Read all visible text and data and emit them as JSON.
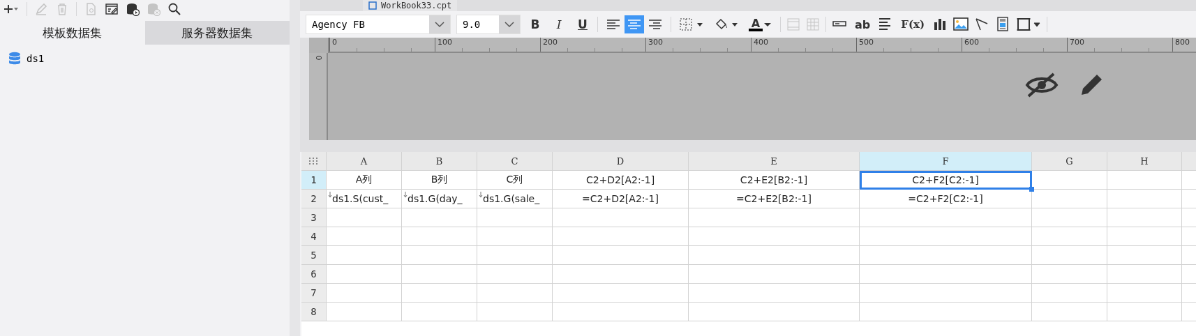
{
  "dataset_panel": {
    "tabs": [
      {
        "label": "模板数据集",
        "selected": true
      },
      {
        "label": "服务器数据集",
        "selected": false
      }
    ],
    "datasets": [
      {
        "name": "ds1"
      }
    ]
  },
  "file_tab": {
    "label": "WorkBook33.cpt"
  },
  "format_toolbar": {
    "font": "Agency FB",
    "size": "9.0",
    "style_buttons": [
      {
        "kind": "bold",
        "label": "B"
      },
      {
        "kind": "italic",
        "label": "I"
      },
      {
        "kind": "underline",
        "label": "U"
      }
    ],
    "align_buttons": [
      {
        "kind": "left",
        "selected": false
      },
      {
        "kind": "center",
        "selected": true
      },
      {
        "kind": "right",
        "selected": false
      }
    ],
    "font_color": {
      "label": "A",
      "color": "#000000"
    },
    "insert_buttons": [
      {
        "kind": "field"
      },
      {
        "kind": "text",
        "label": "ab"
      },
      {
        "kind": "lines"
      },
      {
        "kind": "formula",
        "label": "F(x)"
      },
      {
        "kind": "chart"
      },
      {
        "kind": "image"
      },
      {
        "kind": "slash"
      },
      {
        "kind": "subreport"
      }
    ]
  },
  "ruler": {
    "ticks": [
      "0",
      "100",
      "200",
      "300",
      "400",
      "500",
      "600",
      "700",
      "800"
    ],
    "vertical_tick": "0"
  },
  "sheet": {
    "columns": [
      {
        "label": "A",
        "selected": false
      },
      {
        "label": "B",
        "selected": false
      },
      {
        "label": "C",
        "selected": false
      },
      {
        "label": "D",
        "selected": false
      },
      {
        "label": "E",
        "selected": false
      },
      {
        "label": "F",
        "selected": true
      },
      {
        "label": "G",
        "selected": false
      },
      {
        "label": "H",
        "selected": false
      }
    ],
    "rows": [
      {
        "number": "1",
        "selected": true,
        "cells": [
          {
            "text": "A列",
            "kind": "text",
            "selected": false
          },
          {
            "text": "B列",
            "kind": "text",
            "selected": false
          },
          {
            "text": "C列",
            "kind": "text",
            "selected": false
          },
          {
            "text": "C2+D2[A2:-1]",
            "kind": "text",
            "selected": false
          },
          {
            "text": "C2+E2[B2:-1]",
            "kind": "text",
            "selected": false
          },
          {
            "text": "C2+F2[C2:-1]",
            "kind": "text",
            "selected": true
          },
          {
            "text": "",
            "kind": "text",
            "selected": false
          },
          {
            "text": "",
            "kind": "text",
            "selected": false
          }
        ]
      },
      {
        "number": "2",
        "selected": false,
        "cells": [
          {
            "text": "ds1.S(cust_",
            "kind": "expand",
            "selected": false
          },
          {
            "text": "ds1.G(day_",
            "kind": "expand",
            "selected": false
          },
          {
            "text": "ds1.G(sale_",
            "kind": "expand",
            "selected": false
          },
          {
            "text": "=C2+D2[A2:-1]",
            "kind": "text",
            "selected": false
          },
          {
            "text": "=C2+E2[B2:-1]",
            "kind": "text",
            "selected": false
          },
          {
            "text": "=C2+F2[C2:-1]",
            "kind": "text",
            "selected": false
          },
          {
            "text": "",
            "kind": "text",
            "selected": false
          },
          {
            "text": "",
            "kind": "text",
            "selected": false
          }
        ]
      },
      {
        "number": "3",
        "selected": false,
        "cells": []
      },
      {
        "number": "4",
        "selected": false,
        "cells": []
      },
      {
        "number": "5",
        "selected": false,
        "cells": []
      },
      {
        "number": "6",
        "selected": false,
        "cells": []
      },
      {
        "number": "7",
        "selected": false,
        "cells": []
      },
      {
        "number": "8",
        "selected": false,
        "cells": []
      }
    ]
  }
}
